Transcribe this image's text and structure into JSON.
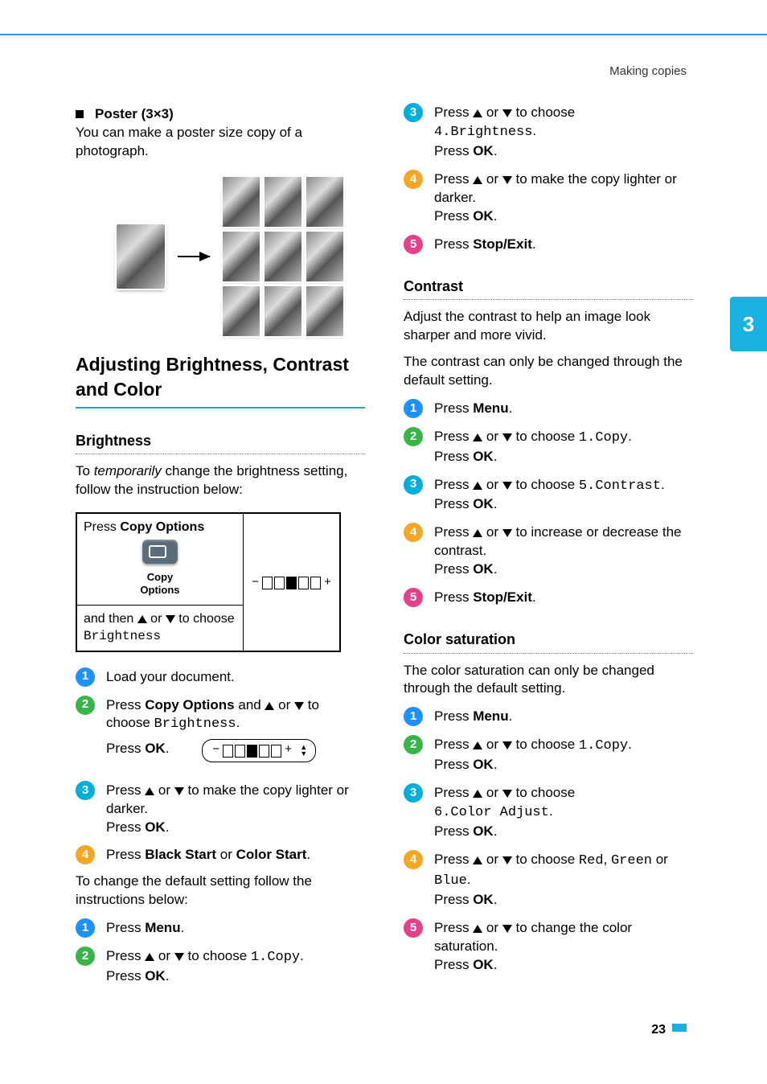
{
  "header": {
    "section": "Making copies"
  },
  "chapter": {
    "number": "3"
  },
  "poster": {
    "title": "Poster (3×3)",
    "desc": "You can make a poster size copy of a photograph."
  },
  "adjust": {
    "heading": "Adjusting Brightness, Contrast and Color"
  },
  "brightness": {
    "heading": "Brightness",
    "intro_pre": "To ",
    "intro_em": "temporarily",
    "intro_post": " change the brightness setting, follow the instruction below:",
    "table": {
      "row1_pre": "Press ",
      "row1_bold": "Copy  Options",
      "button_line1": "Copy",
      "button_line2": "Options",
      "row2_pre": "and then ",
      "row2_mid": " or ",
      "row2_post": " to choose",
      "row2_mono": "Brightness",
      "level_minus": "−",
      "level_plus": "+"
    },
    "steps_temp": [
      {
        "n": "1",
        "text": "Load your document."
      },
      {
        "n": "2",
        "pre": "Press ",
        "b1": "Copy Options",
        "mid": " and ",
        "mid2": " or ",
        "post": " to choose ",
        "mono": "Brightness",
        "tail": ".",
        "ok_pre": "Press ",
        "ok_b": "OK",
        "ok_post": "."
      },
      {
        "n": "3",
        "pre": "Press ",
        "mid": " or ",
        "post": " to make the copy lighter or darker.",
        "ok_pre": "Press ",
        "ok_b": "OK",
        "ok_post": "."
      },
      {
        "n": "4",
        "pre": "Press ",
        "b1": "Black Start",
        "mid": " or ",
        "b2": "Color Start",
        "post": "."
      }
    ],
    "default_intro": "To change the default setting follow the instructions below:",
    "steps_default_left": [
      {
        "n": "1",
        "pre": "Press ",
        "b1": "Menu",
        "post": "."
      },
      {
        "n": "2",
        "pre": "Press ",
        "mid": " or ",
        "post": " to choose ",
        "mono": "1.Copy",
        "tail": ".",
        "ok_pre": "Press ",
        "ok_b": "OK",
        "ok_post": "."
      }
    ]
  },
  "right_top_steps": [
    {
      "n": "3",
      "pre": "Press ",
      "mid": " or ",
      "post": " to choose ",
      "mono": "4.Brightness",
      "tail": ".",
      "ok_pre": "Press ",
      "ok_b": "OK",
      "ok_post": "."
    },
    {
      "n": "4",
      "pre": "Press ",
      "mid": " or ",
      "post": " to make the copy lighter or darker.",
      "ok_pre": "Press ",
      "ok_b": "OK",
      "ok_post": "."
    },
    {
      "n": "5",
      "pre": "Press ",
      "b1": "Stop/Exit",
      "post": "."
    }
  ],
  "contrast": {
    "heading": "Contrast",
    "p1": "Adjust the contrast to help an image look sharper and more vivid.",
    "p2": "The contrast can only be changed through the default setting.",
    "steps": [
      {
        "n": "1",
        "pre": "Press ",
        "b1": "Menu",
        "post": "."
      },
      {
        "n": "2",
        "pre": "Press ",
        "mid": " or ",
        "post": " to choose ",
        "mono": "1.Copy",
        "tail": ".",
        "ok_pre": "Press ",
        "ok_b": "OK",
        "ok_post": "."
      },
      {
        "n": "3",
        "pre": "Press ",
        "mid": " or ",
        "post": " to choose ",
        "mono": "5.Contrast",
        "tail": ".",
        "ok_pre": "Press ",
        "ok_b": "OK",
        "ok_post": "."
      },
      {
        "n": "4",
        "pre": "Press ",
        "mid": " or ",
        "post": " to increase or decrease the contrast.",
        "ok_pre": "Press ",
        "ok_b": "OK",
        "ok_post": "."
      },
      {
        "n": "5",
        "pre": "Press ",
        "b1": "Stop/Exit",
        "post": "."
      }
    ]
  },
  "color": {
    "heading": "Color saturation",
    "p1": "The color saturation can only be changed through the default setting.",
    "steps": [
      {
        "n": "1",
        "pre": "Press ",
        "b1": "Menu",
        "post": "."
      },
      {
        "n": "2",
        "pre": "Press ",
        "mid": " or ",
        "post": " to choose ",
        "mono": "1.Copy",
        "tail": ".",
        "ok_pre": "Press ",
        "ok_b": "OK",
        "ok_post": "."
      },
      {
        "n": "3",
        "pre": "Press ",
        "mid": " or ",
        "post": " to choose ",
        "mono": "6.Color Adjust",
        "tail": ".",
        "ok_pre": "Press ",
        "ok_b": "OK",
        "ok_post": "."
      },
      {
        "n": "4",
        "pre": "Press ",
        "mid": " or ",
        "post": " to choose ",
        "mono1": "Red",
        "sep1": ", ",
        "mono2": "Green",
        "sep2": " or ",
        "mono3": "Blue",
        "tail": ".",
        "ok_pre": "Press ",
        "ok_b": "OK",
        "ok_post": "."
      },
      {
        "n": "5",
        "pre": "Press ",
        "mid": " or ",
        "post": " to change the color saturation.",
        "ok_pre": "Press ",
        "ok_b": "OK",
        "ok_post": "."
      }
    ]
  },
  "footer": {
    "page": "23"
  }
}
